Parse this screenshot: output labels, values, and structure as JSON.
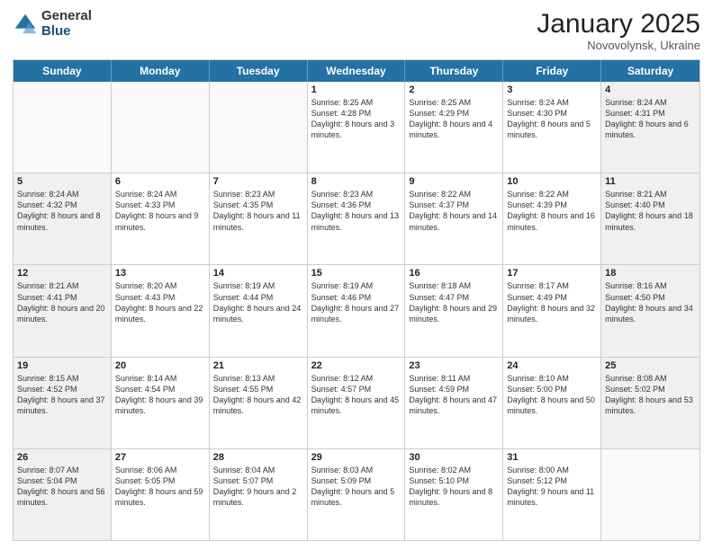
{
  "logo": {
    "general": "General",
    "blue": "Blue"
  },
  "header": {
    "month": "January 2025",
    "location": "Novovolynsk, Ukraine"
  },
  "days": [
    "Sunday",
    "Monday",
    "Tuesday",
    "Wednesday",
    "Thursday",
    "Friday",
    "Saturday"
  ],
  "rows": [
    [
      {
        "day": "",
        "text": "",
        "empty": true
      },
      {
        "day": "",
        "text": "",
        "empty": true
      },
      {
        "day": "",
        "text": "",
        "empty": true
      },
      {
        "day": "1",
        "text": "Sunrise: 8:25 AM\nSunset: 4:28 PM\nDaylight: 8 hours and 3 minutes.",
        "shaded": false
      },
      {
        "day": "2",
        "text": "Sunrise: 8:25 AM\nSunset: 4:29 PM\nDaylight: 8 hours and 4 minutes.",
        "shaded": false
      },
      {
        "day": "3",
        "text": "Sunrise: 8:24 AM\nSunset: 4:30 PM\nDaylight: 8 hours and 5 minutes.",
        "shaded": false
      },
      {
        "day": "4",
        "text": "Sunrise: 8:24 AM\nSunset: 4:31 PM\nDaylight: 8 hours and 6 minutes.",
        "shaded": true
      }
    ],
    [
      {
        "day": "5",
        "text": "Sunrise: 8:24 AM\nSunset: 4:32 PM\nDaylight: 8 hours and 8 minutes.",
        "shaded": true
      },
      {
        "day": "6",
        "text": "Sunrise: 8:24 AM\nSunset: 4:33 PM\nDaylight: 8 hours and 9 minutes.",
        "shaded": false
      },
      {
        "day": "7",
        "text": "Sunrise: 8:23 AM\nSunset: 4:35 PM\nDaylight: 8 hours and 11 minutes.",
        "shaded": false
      },
      {
        "day": "8",
        "text": "Sunrise: 8:23 AM\nSunset: 4:36 PM\nDaylight: 8 hours and 13 minutes.",
        "shaded": false
      },
      {
        "day": "9",
        "text": "Sunrise: 8:22 AM\nSunset: 4:37 PM\nDaylight: 8 hours and 14 minutes.",
        "shaded": false
      },
      {
        "day": "10",
        "text": "Sunrise: 8:22 AM\nSunset: 4:39 PM\nDaylight: 8 hours and 16 minutes.",
        "shaded": false
      },
      {
        "day": "11",
        "text": "Sunrise: 8:21 AM\nSunset: 4:40 PM\nDaylight: 8 hours and 18 minutes.",
        "shaded": true
      }
    ],
    [
      {
        "day": "12",
        "text": "Sunrise: 8:21 AM\nSunset: 4:41 PM\nDaylight: 8 hours and 20 minutes.",
        "shaded": true
      },
      {
        "day": "13",
        "text": "Sunrise: 8:20 AM\nSunset: 4:43 PM\nDaylight: 8 hours and 22 minutes.",
        "shaded": false
      },
      {
        "day": "14",
        "text": "Sunrise: 8:19 AM\nSunset: 4:44 PM\nDaylight: 8 hours and 24 minutes.",
        "shaded": false
      },
      {
        "day": "15",
        "text": "Sunrise: 8:19 AM\nSunset: 4:46 PM\nDaylight: 8 hours and 27 minutes.",
        "shaded": false
      },
      {
        "day": "16",
        "text": "Sunrise: 8:18 AM\nSunset: 4:47 PM\nDaylight: 8 hours and 29 minutes.",
        "shaded": false
      },
      {
        "day": "17",
        "text": "Sunrise: 8:17 AM\nSunset: 4:49 PM\nDaylight: 8 hours and 32 minutes.",
        "shaded": false
      },
      {
        "day": "18",
        "text": "Sunrise: 8:16 AM\nSunset: 4:50 PM\nDaylight: 8 hours and 34 minutes.",
        "shaded": true
      }
    ],
    [
      {
        "day": "19",
        "text": "Sunrise: 8:15 AM\nSunset: 4:52 PM\nDaylight: 8 hours and 37 minutes.",
        "shaded": true
      },
      {
        "day": "20",
        "text": "Sunrise: 8:14 AM\nSunset: 4:54 PM\nDaylight: 8 hours and 39 minutes.",
        "shaded": false
      },
      {
        "day": "21",
        "text": "Sunrise: 8:13 AM\nSunset: 4:55 PM\nDaylight: 8 hours and 42 minutes.",
        "shaded": false
      },
      {
        "day": "22",
        "text": "Sunrise: 8:12 AM\nSunset: 4:57 PM\nDaylight: 8 hours and 45 minutes.",
        "shaded": false
      },
      {
        "day": "23",
        "text": "Sunrise: 8:11 AM\nSunset: 4:59 PM\nDaylight: 8 hours and 47 minutes.",
        "shaded": false
      },
      {
        "day": "24",
        "text": "Sunrise: 8:10 AM\nSunset: 5:00 PM\nDaylight: 8 hours and 50 minutes.",
        "shaded": false
      },
      {
        "day": "25",
        "text": "Sunrise: 8:08 AM\nSunset: 5:02 PM\nDaylight: 8 hours and 53 minutes.",
        "shaded": true
      }
    ],
    [
      {
        "day": "26",
        "text": "Sunrise: 8:07 AM\nSunset: 5:04 PM\nDaylight: 8 hours and 56 minutes.",
        "shaded": true
      },
      {
        "day": "27",
        "text": "Sunrise: 8:06 AM\nSunset: 5:05 PM\nDaylight: 8 hours and 59 minutes.",
        "shaded": false
      },
      {
        "day": "28",
        "text": "Sunrise: 8:04 AM\nSunset: 5:07 PM\nDaylight: 9 hours and 2 minutes.",
        "shaded": false
      },
      {
        "day": "29",
        "text": "Sunrise: 8:03 AM\nSunset: 5:09 PM\nDaylight: 9 hours and 5 minutes.",
        "shaded": false
      },
      {
        "day": "30",
        "text": "Sunrise: 8:02 AM\nSunset: 5:10 PM\nDaylight: 9 hours and 8 minutes.",
        "shaded": false
      },
      {
        "day": "31",
        "text": "Sunrise: 8:00 AM\nSunset: 5:12 PM\nDaylight: 9 hours and 11 minutes.",
        "shaded": false
      },
      {
        "day": "",
        "text": "",
        "empty": true
      }
    ]
  ]
}
